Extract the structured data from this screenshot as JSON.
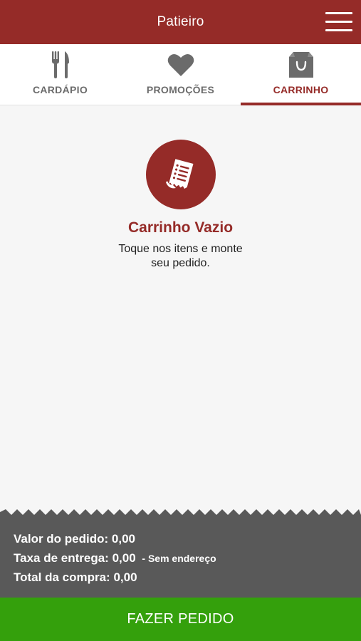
{
  "header": {
    "title": "Patieiro",
    "menu_icon": "hamburger-menu-icon"
  },
  "tabs": [
    {
      "label": "CARDÁPIO",
      "icon": "fork-knife-icon",
      "active": false
    },
    {
      "label": "PROMOÇÕES",
      "icon": "heart-icon",
      "active": false
    },
    {
      "label": "CARRINHO",
      "icon": "shopping-bag-icon",
      "active": true
    }
  ],
  "empty_cart": {
    "icon": "receipt-icon",
    "title": "Carrinho Vazio",
    "subtitle": "Toque nos itens e monte seu pedido."
  },
  "summary": {
    "order_value_label": "Valor do pedido:",
    "order_value": "0,00",
    "delivery_fee_label": "Taxa de entrega:",
    "delivery_fee": "0,00",
    "delivery_note": "- Sem endereço",
    "total_label": "Total da compra:",
    "total": "0,00"
  },
  "footer": {
    "order_button": "FAZER PEDIDO"
  },
  "colors": {
    "brand": "#952b28",
    "summary_bg": "#595959",
    "action": "#34a00c",
    "background": "#f6f6f6"
  }
}
